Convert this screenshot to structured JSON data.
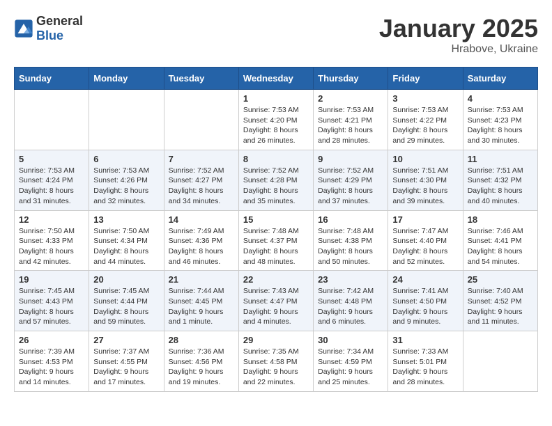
{
  "header": {
    "logo_general": "General",
    "logo_blue": "Blue",
    "month_title": "January 2025",
    "location": "Hrabove, Ukraine"
  },
  "weekdays": [
    "Sunday",
    "Monday",
    "Tuesday",
    "Wednesday",
    "Thursday",
    "Friday",
    "Saturday"
  ],
  "weeks": [
    [
      {
        "day": "",
        "info": ""
      },
      {
        "day": "",
        "info": ""
      },
      {
        "day": "",
        "info": ""
      },
      {
        "day": "1",
        "info": "Sunrise: 7:53 AM\nSunset: 4:20 PM\nDaylight: 8 hours and 26 minutes."
      },
      {
        "day": "2",
        "info": "Sunrise: 7:53 AM\nSunset: 4:21 PM\nDaylight: 8 hours and 28 minutes."
      },
      {
        "day": "3",
        "info": "Sunrise: 7:53 AM\nSunset: 4:22 PM\nDaylight: 8 hours and 29 minutes."
      },
      {
        "day": "4",
        "info": "Sunrise: 7:53 AM\nSunset: 4:23 PM\nDaylight: 8 hours and 30 minutes."
      }
    ],
    [
      {
        "day": "5",
        "info": "Sunrise: 7:53 AM\nSunset: 4:24 PM\nDaylight: 8 hours and 31 minutes."
      },
      {
        "day": "6",
        "info": "Sunrise: 7:53 AM\nSunset: 4:26 PM\nDaylight: 8 hours and 32 minutes."
      },
      {
        "day": "7",
        "info": "Sunrise: 7:52 AM\nSunset: 4:27 PM\nDaylight: 8 hours and 34 minutes."
      },
      {
        "day": "8",
        "info": "Sunrise: 7:52 AM\nSunset: 4:28 PM\nDaylight: 8 hours and 35 minutes."
      },
      {
        "day": "9",
        "info": "Sunrise: 7:52 AM\nSunset: 4:29 PM\nDaylight: 8 hours and 37 minutes."
      },
      {
        "day": "10",
        "info": "Sunrise: 7:51 AM\nSunset: 4:30 PM\nDaylight: 8 hours and 39 minutes."
      },
      {
        "day": "11",
        "info": "Sunrise: 7:51 AM\nSunset: 4:32 PM\nDaylight: 8 hours and 40 minutes."
      }
    ],
    [
      {
        "day": "12",
        "info": "Sunrise: 7:50 AM\nSunset: 4:33 PM\nDaylight: 8 hours and 42 minutes."
      },
      {
        "day": "13",
        "info": "Sunrise: 7:50 AM\nSunset: 4:34 PM\nDaylight: 8 hours and 44 minutes."
      },
      {
        "day": "14",
        "info": "Sunrise: 7:49 AM\nSunset: 4:36 PM\nDaylight: 8 hours and 46 minutes."
      },
      {
        "day": "15",
        "info": "Sunrise: 7:48 AM\nSunset: 4:37 PM\nDaylight: 8 hours and 48 minutes."
      },
      {
        "day": "16",
        "info": "Sunrise: 7:48 AM\nSunset: 4:38 PM\nDaylight: 8 hours and 50 minutes."
      },
      {
        "day": "17",
        "info": "Sunrise: 7:47 AM\nSunset: 4:40 PM\nDaylight: 8 hours and 52 minutes."
      },
      {
        "day": "18",
        "info": "Sunrise: 7:46 AM\nSunset: 4:41 PM\nDaylight: 8 hours and 54 minutes."
      }
    ],
    [
      {
        "day": "19",
        "info": "Sunrise: 7:45 AM\nSunset: 4:43 PM\nDaylight: 8 hours and 57 minutes."
      },
      {
        "day": "20",
        "info": "Sunrise: 7:45 AM\nSunset: 4:44 PM\nDaylight: 8 hours and 59 minutes."
      },
      {
        "day": "21",
        "info": "Sunrise: 7:44 AM\nSunset: 4:45 PM\nDaylight: 9 hours and 1 minute."
      },
      {
        "day": "22",
        "info": "Sunrise: 7:43 AM\nSunset: 4:47 PM\nDaylight: 9 hours and 4 minutes."
      },
      {
        "day": "23",
        "info": "Sunrise: 7:42 AM\nSunset: 4:48 PM\nDaylight: 9 hours and 6 minutes."
      },
      {
        "day": "24",
        "info": "Sunrise: 7:41 AM\nSunset: 4:50 PM\nDaylight: 9 hours and 9 minutes."
      },
      {
        "day": "25",
        "info": "Sunrise: 7:40 AM\nSunset: 4:52 PM\nDaylight: 9 hours and 11 minutes."
      }
    ],
    [
      {
        "day": "26",
        "info": "Sunrise: 7:39 AM\nSunset: 4:53 PM\nDaylight: 9 hours and 14 minutes."
      },
      {
        "day": "27",
        "info": "Sunrise: 7:37 AM\nSunset: 4:55 PM\nDaylight: 9 hours and 17 minutes."
      },
      {
        "day": "28",
        "info": "Sunrise: 7:36 AM\nSunset: 4:56 PM\nDaylight: 9 hours and 19 minutes."
      },
      {
        "day": "29",
        "info": "Sunrise: 7:35 AM\nSunset: 4:58 PM\nDaylight: 9 hours and 22 minutes."
      },
      {
        "day": "30",
        "info": "Sunrise: 7:34 AM\nSunset: 4:59 PM\nDaylight: 9 hours and 25 minutes."
      },
      {
        "day": "31",
        "info": "Sunrise: 7:33 AM\nSunset: 5:01 PM\nDaylight: 9 hours and 28 minutes."
      },
      {
        "day": "",
        "info": ""
      }
    ]
  ]
}
